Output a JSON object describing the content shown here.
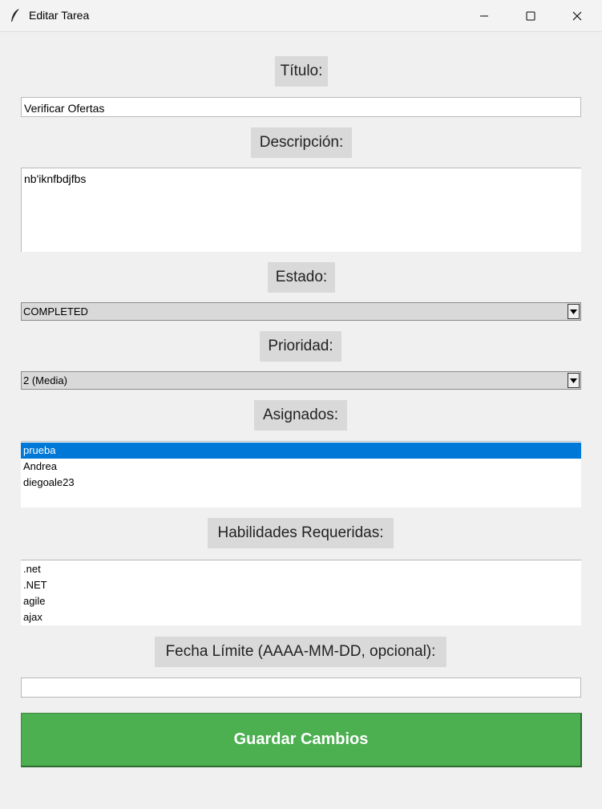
{
  "window": {
    "title": "Editar Tarea",
    "minimize_icon": "minimize-icon",
    "maximize_icon": "maximize-icon",
    "close_icon": "close-icon"
  },
  "form": {
    "title_label": "Título:",
    "title_value": "Verificar Ofertas",
    "description_label": "Descripción:",
    "description_value": "nb'iknfbdjfbs",
    "status_label": "Estado:",
    "status_value": "COMPLETED",
    "priority_label": "Prioridad:",
    "priority_value": "2 (Media)",
    "assigned_label": "Asignados:",
    "assigned_items": [
      "prueba",
      "Andrea",
      "diegoale23"
    ],
    "assigned_selected": "prueba",
    "skills_label": "Habilidades Requeridas:",
    "skills_items": [
      ".net",
      ".NET",
      "agile",
      "ajax"
    ],
    "deadline_label": "Fecha Límite (AAAA-MM-DD, opcional):",
    "deadline_value": "",
    "save_label": "Guardar Cambios"
  },
  "colors": {
    "save_button": "#4caf50",
    "selection": "#0078d7",
    "label_bg": "#d9d9d9"
  }
}
